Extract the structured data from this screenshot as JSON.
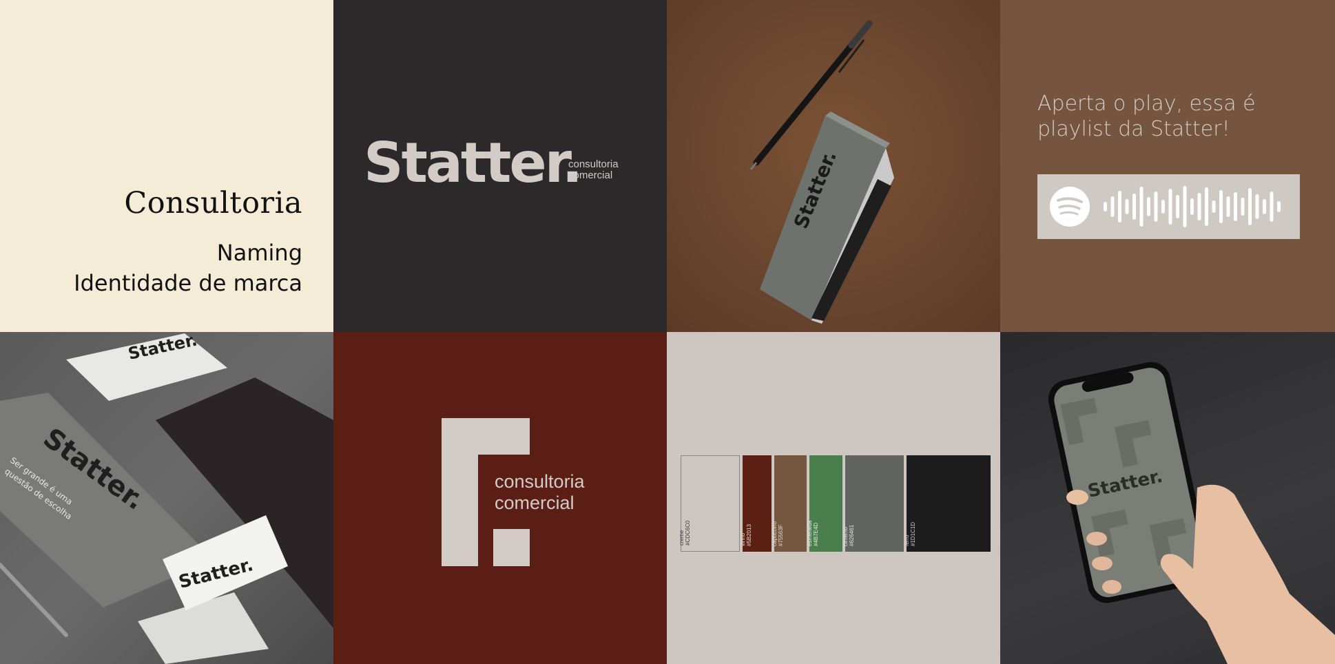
{
  "intro": {
    "title": "Consultoria",
    "line1": "Naming",
    "line2": "Identidade de marca"
  },
  "logo": {
    "word": "Statter.",
    "sub1": "consultoria",
    "sub2": "comercial"
  },
  "notebook": {
    "brand": "Statter."
  },
  "playlist": {
    "line1": "Aperta o play, essa é",
    "line2": "playlist da Statter!",
    "icon": "spotify-icon"
  },
  "stationery": {
    "brand": "Statter.",
    "tagline1": "Ser grande é uma",
    "tagline2": "questão de escolha"
  },
  "symbol": {
    "sub1": "consultoria",
    "sub2": "comercial"
  },
  "palette": {
    "swatches": [
      {
        "name": "creme",
        "hex": "#CDC6C0",
        "color": "#cdc6c0",
        "text": "#3a3a3a"
      },
      {
        "name": "vinho",
        "hex": "#5B2013",
        "color": "#5b2013",
        "text": "#e0d6d0"
      },
      {
        "name": "capuccino",
        "hex": "#75563F",
        "color": "#75563f",
        "text": "#e0d6d0"
      },
      {
        "name": "esmeralda",
        "hex": "#4B7E4D",
        "color": "#4b7e4d",
        "text": "#e0e8e0"
      },
      {
        "name": "cimento",
        "hex": "#626461",
        "color": "#626461",
        "text": "#e0e0e0"
      },
      {
        "name": "ferro",
        "hex": "#1D1C1D",
        "color": "#1d1c1d",
        "text": "#d0d0d0"
      }
    ]
  },
  "phone": {
    "brand": "Statter."
  }
}
